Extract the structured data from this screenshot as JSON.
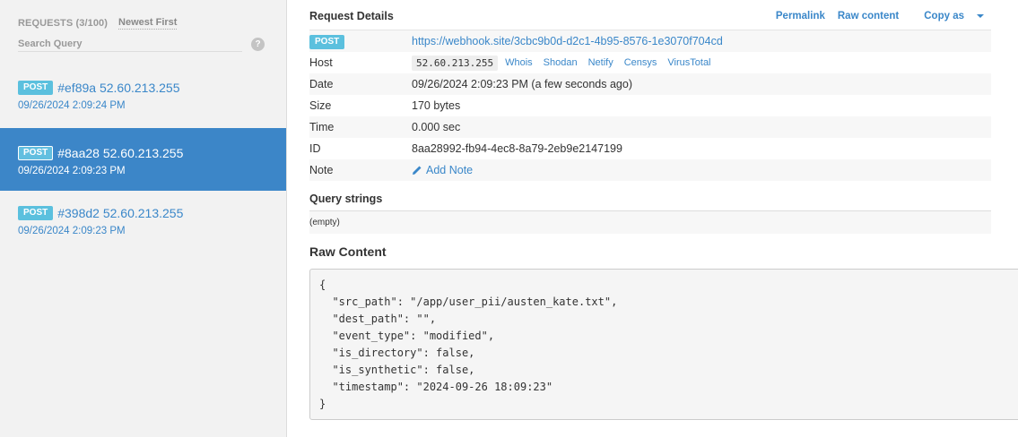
{
  "sidebar": {
    "count_label": "REQUESTS (3/100)",
    "sort_label": "Newest First",
    "search_placeholder": "Search Query",
    "help_glyph": "?",
    "requests": [
      {
        "method": "POST",
        "title": "#ef89a 52.60.213.255",
        "time": "09/26/2024 2:09:24 PM",
        "active": false
      },
      {
        "method": "POST",
        "title": "#8aa28 52.60.213.255",
        "time": "09/26/2024 2:09:23 PM",
        "active": true
      },
      {
        "method": "POST",
        "title": "#398d2 52.60.213.255",
        "time": "09/26/2024 2:09:23 PM",
        "active": false
      }
    ]
  },
  "details": {
    "title": "Request Details",
    "actions": {
      "permalink": "Permalink",
      "raw_content": "Raw content",
      "copy_as": "Copy as"
    },
    "method": "POST",
    "url": "https://webhook.site/3cbc9b0d-d2c1-4b95-8576-1e3070f704cd",
    "host_label": "Host",
    "host": "52.60.213.255",
    "host_links": [
      "Whois",
      "Shodan",
      "Netify",
      "Censys",
      "VirusTotal"
    ],
    "date_label": "Date",
    "date": "09/26/2024 2:09:23 PM (a few seconds ago)",
    "size_label": "Size",
    "size": "170 bytes",
    "time_label": "Time",
    "time": "0.000 sec",
    "id_label": "ID",
    "id": "8aa28992-fb94-4ec8-8a79-2eb9e2147199",
    "note_label": "Note",
    "add_note": "Add Note"
  },
  "query": {
    "title": "Query strings",
    "value": "(empty)"
  },
  "raw": {
    "title": "Raw Content",
    "content": "{\n  \"src_path\": \"/app/user_pii/austen_kate.txt\",\n  \"dest_path\": \"\",\n  \"event_type\": \"modified\",\n  \"is_directory\": false,\n  \"is_synthetic\": false,\n  \"timestamp\": \"2024-09-26 18:09:23\"\n}"
  },
  "colors": {
    "link": "#3a87c9",
    "badge": "#5bc0de",
    "active_row": "#3c86c8"
  }
}
